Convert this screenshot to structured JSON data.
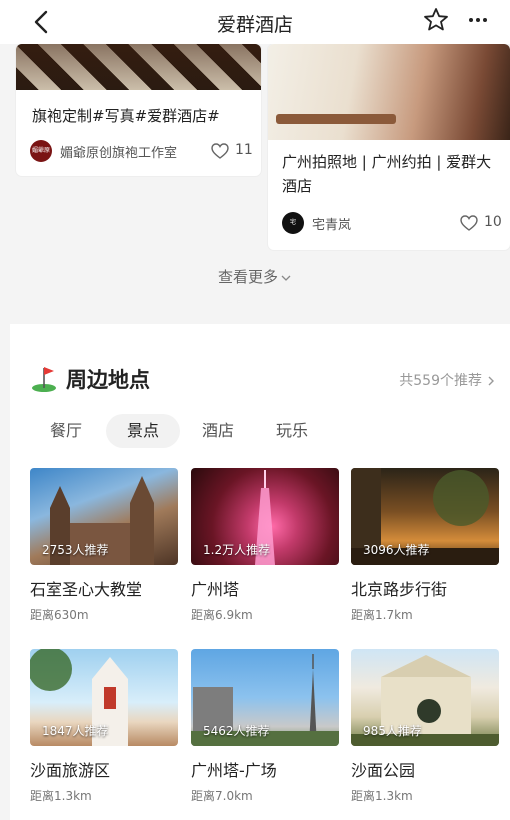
{
  "header": {
    "title": "爱群酒店",
    "back_icon": "back-arrow-icon",
    "favorite_icon": "star-outline-icon",
    "more_icon": "more-dots-icon"
  },
  "notes": [
    {
      "title": "旗袍定制#写真#爱群酒店#",
      "author": "媚爺原创旗袍工作室",
      "avatar_text": "媚爺原创",
      "likes": "11"
    },
    {
      "title": "广州拍照地 | 广州约拍 | 爱群大酒店",
      "author": "宅青岚",
      "avatar_text": "宅",
      "likes": "10"
    }
  ],
  "see_more": "查看更多",
  "nearby": {
    "title": "周边地点",
    "total": "共559个推荐",
    "tabs": [
      "餐厅",
      "景点",
      "酒店",
      "玩乐"
    ],
    "active_tab": "景点",
    "places": [
      {
        "name": "石室圣心大教堂",
        "badge": "2753人推荐",
        "distance": "距离630m"
      },
      {
        "name": "广州塔",
        "badge": "1.2万人推荐",
        "distance": "距离6.9km"
      },
      {
        "name": "北京路步行街",
        "badge": "3096人推荐",
        "distance": "距离1.7km"
      },
      {
        "name": "沙面旅游区",
        "badge": "1847人推荐",
        "distance": "距离1.3km"
      },
      {
        "name": "广州塔-广场",
        "badge": "5462人推荐",
        "distance": "距离7.0km"
      },
      {
        "name": "沙面公园",
        "badge": "985人推荐",
        "distance": "距离1.3km"
      }
    ]
  },
  "colors": {
    "background": "#f4f4f4",
    "card": "#ffffff",
    "muted_text": "#999999",
    "tab_active_bg": "#f2f2f2"
  }
}
